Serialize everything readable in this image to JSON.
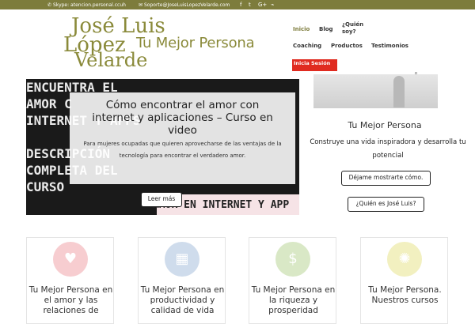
{
  "topbar": {
    "skype": "Skype: atencion.personal.ccuh",
    "email": "Soporte@JoseLuisLopezVelarde.com",
    "social_icons": [
      "facebook-icon",
      "twitter-icon",
      "google-plus-icon",
      "rss-icon"
    ]
  },
  "logo": {
    "line1": "José Luis",
    "line2": "López",
    "line3": "Velarde",
    "tagline": "Tu Mejor Persona"
  },
  "nav": {
    "inicio": "Inicio",
    "blog": "Blog",
    "quien": "¿Quién soy?",
    "coaching": "Coaching",
    "productos": "Productos",
    "testimonios": "Testimonios",
    "inicia": "Inicia Sesión"
  },
  "colors": {
    "accent": "#7d7c3c",
    "red": "#e02b20"
  },
  "hero": {
    "bg_text": [
      "ENCUENTRA EL",
      "AMOR C",
      "INTERNET Y APPS",
      "",
      "DESCRIPCIÓN",
      "COMPLETA DEL",
      "CURSO"
    ],
    "strip_text": "AMOR EN INTERNET Y APP",
    "title": "Cómo encontrar el amor con internet y aplicaciones – Curso en video",
    "description": "Para mujeres ocupadas que quieren aprovecharse de las ventajas de la tecnología para encontrar el verdadero amor.",
    "button": "Leer más"
  },
  "sidebar": {
    "title": "Tu Mejor Persona",
    "text": "Construye una vida inspiradora y desarrolla tu potencial",
    "button1": "Déjame mostrarte cómo.",
    "button2": "¿Quién es José Luis?"
  },
  "cards": [
    {
      "title": "Tu Mejor Persona en el amor y las relaciones de",
      "icon": "heart-icon",
      "color": "#f7cdd0"
    },
    {
      "title": "Tu Mejor Persona en productividad y calidad de vida",
      "icon": "calendar-icon",
      "color": "#cfdcec"
    },
    {
      "title": "Tu Mejor Persona en la riqueza y prosperidad",
      "icon": "dollar-icon",
      "color": "#d9e8c6"
    },
    {
      "title": "Tu Mejor Persona. Nuestros cursos",
      "icon": "lightbulb-icon",
      "color": "#f2f0c0"
    }
  ]
}
